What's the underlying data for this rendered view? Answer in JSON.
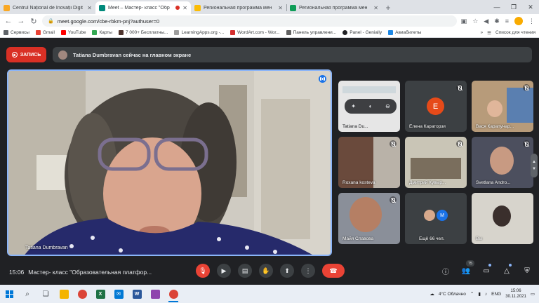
{
  "browser": {
    "tabs": [
      {
        "title": "Centrul Național de Inovații Digit",
        "favicon_color": "#f9a825",
        "active": false
      },
      {
        "title": "Meet – Мастер- класс \"Обр",
        "favicon_color": "#00897b",
        "active": true,
        "recording": true
      },
      {
        "title": "Региональная программа мен",
        "favicon_color": "#fbbc04",
        "active": false
      },
      {
        "title": "Региональная программа мен",
        "favicon_color": "#0f9d58",
        "active": false
      }
    ],
    "url": "meet.google.com/cbe-rbkm-pnj?authuser=0",
    "bookmarks": [
      {
        "label": "Сервисы",
        "color": "#5f6368"
      },
      {
        "label": "Gmail",
        "color": "#ea4335"
      },
      {
        "label": "YouTube",
        "color": "#ff0000"
      },
      {
        "label": "Карты",
        "color": "#34a853"
      },
      {
        "label": "7 000+ Бесплатны...",
        "color": "#4e342e"
      },
      {
        "label": "LearningApps.org -...",
        "color": "#9e9e9e"
      },
      {
        "label": "WordArt.com - Wor...",
        "color": "#d32f2f"
      },
      {
        "label": "Панель управлени...",
        "color": "#616161"
      },
      {
        "label": "Panel - Genially",
        "color": "#202124"
      },
      {
        "label": "Авиабилеты",
        "color": "#1e88e5"
      }
    ],
    "reading_list": "Список для чтения"
  },
  "meet": {
    "record_label": "ЗАПИСЬ",
    "presenting_banner": "Tatiana Dumbravan сейчас на главном экране",
    "main_tile_name": "Tatiana Dumbravan",
    "tiles": [
      {
        "name": "Tatiana Du...",
        "type": "screen"
      },
      {
        "name": "Елена Караторзи",
        "type": "avatar",
        "initial": "Е"
      },
      {
        "name": "Вася Карапунар...",
        "type": "video"
      },
      {
        "name": "Roxana kosteva",
        "type": "video"
      },
      {
        "name": "Дмитрий Кувыр...",
        "type": "video"
      },
      {
        "name": "Svetlana Andro...",
        "type": "video"
      },
      {
        "name": "Майя Славова",
        "type": "video"
      },
      {
        "name": "Ещё 66 чел.",
        "type": "more",
        "initial": "M"
      },
      {
        "name": "Вы",
        "type": "video"
      }
    ],
    "time": "15:06",
    "meeting_title": "Мастер- класс \"Образовательная платфор...",
    "participants_count": "75"
  },
  "taskbar": {
    "weather": "4°C Облачно",
    "lang": "ENG",
    "time": "15:06",
    "date": "30.11.2021"
  }
}
